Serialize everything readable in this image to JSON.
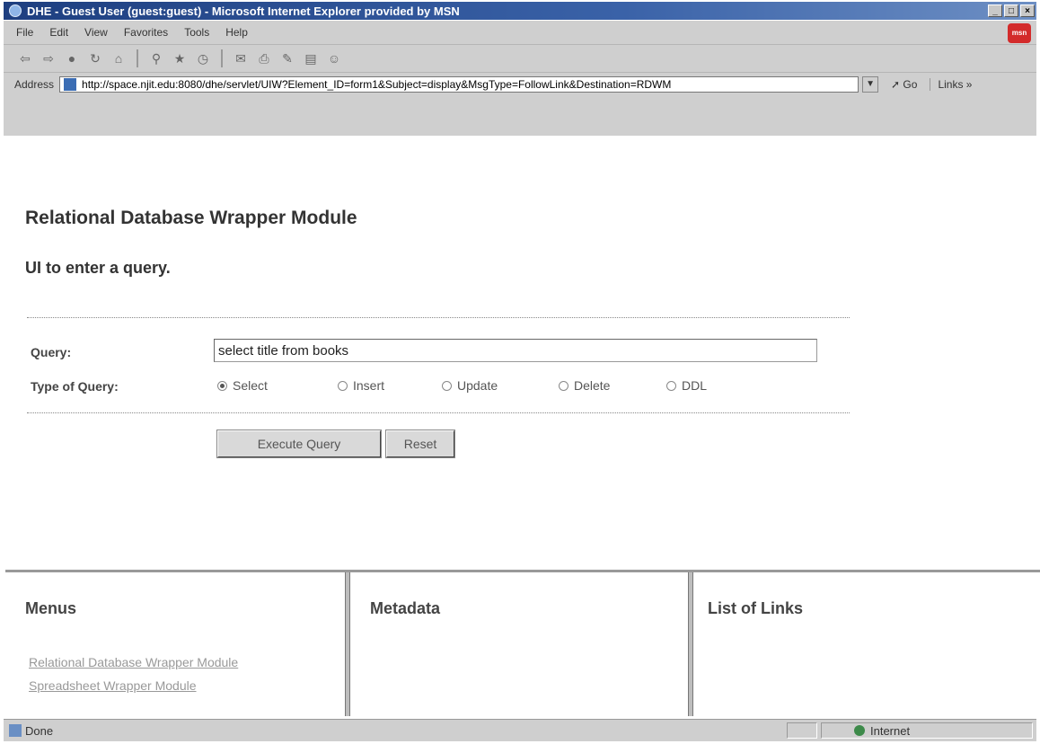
{
  "window": {
    "title": "DHE - Guest User (guest:guest) - Microsoft Internet Explorer provided by MSN",
    "btn_min": "_",
    "btn_max": "□",
    "btn_close": "×"
  },
  "menu": {
    "items": [
      "File",
      "Edit",
      "View",
      "Favorites",
      "Tools",
      "Help"
    ]
  },
  "toolbar": {
    "icons": [
      "back-icon",
      "forward-icon",
      "stop-icon",
      "refresh-icon",
      "home-icon",
      "search-icon",
      "favorites-icon",
      "history-icon",
      "mail-icon",
      "print-icon",
      "edit-icon",
      "discuss-icon",
      "messenger-icon"
    ]
  },
  "address": {
    "label": "Address",
    "url": "http://space.njit.edu:8080/dhe/servlet/UIW?Element_ID=form1&Subject=display&MsgType=FollowLink&Destination=RDWM",
    "go": "Go",
    "links": "Links »"
  },
  "page": {
    "title": "Relational Database Wrapper Module",
    "subtitle": "UI to enter a query.",
    "query_label": "Query:",
    "query_value": "select title from books",
    "type_label": "Type of Query:",
    "query_types": [
      "Select",
      "Insert",
      "Update",
      "Delete",
      "DDL"
    ],
    "selected_type": "Select",
    "execute_label": "Execute Query",
    "reset_label": "Reset"
  },
  "frames": {
    "menus_title": "Menus",
    "menu_links": [
      "Relational Database Wrapper Module",
      "Spreadsheet Wrapper Module"
    ],
    "metadata_title": "Metadata",
    "links_title": "List of Links"
  },
  "status": {
    "text": "Done",
    "zone": "Internet"
  },
  "colors": {
    "titlebar": "#1e3f80",
    "chrome": "#cfcfcf",
    "page_bg": "#ffffff"
  }
}
